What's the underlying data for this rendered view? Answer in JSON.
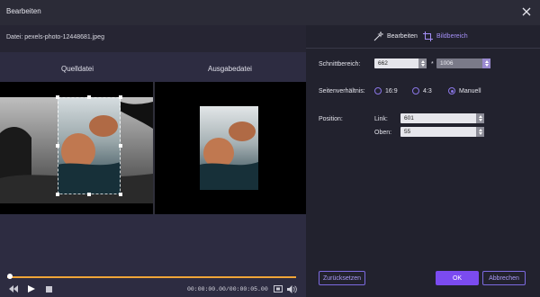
{
  "window": {
    "title": "Bearbeiten",
    "close_icon": "close-icon"
  },
  "file": {
    "label": "Datei: pexels-photo-12448681.jpeg"
  },
  "panes": {
    "source_label": "Quelldatei",
    "output_label": "Ausgabedatei"
  },
  "player": {
    "timecode": "00:00:00.00/00:00:05.00",
    "progress": 0.0
  },
  "tabs": [
    {
      "label": "Bearbeiten",
      "icon": "magic-wand-icon",
      "active": false
    },
    {
      "label": "Bildbereich",
      "icon": "crop-icon",
      "active": true
    }
  ],
  "crop": {
    "area_label": "Schnittbereich:",
    "width": "662",
    "times": "*",
    "height": "1006",
    "ratio_label": "Seitenverhältnis:",
    "ratio_options": [
      {
        "label": "16:9",
        "selected": false
      },
      {
        "label": "4:3",
        "selected": false
      },
      {
        "label": "Manuell",
        "selected": true
      }
    ],
    "position_label": "Position:",
    "left_label": "Link:",
    "left_value": "601",
    "top_label": "Oben:",
    "top_value": "55"
  },
  "buttons": {
    "reset": "Zurücksetzen",
    "ok": "OK",
    "cancel": "Abbrechen"
  },
  "colors": {
    "accent": "#7b4bf0",
    "timeline": "#f0a538",
    "panel": "#2d2c41"
  }
}
